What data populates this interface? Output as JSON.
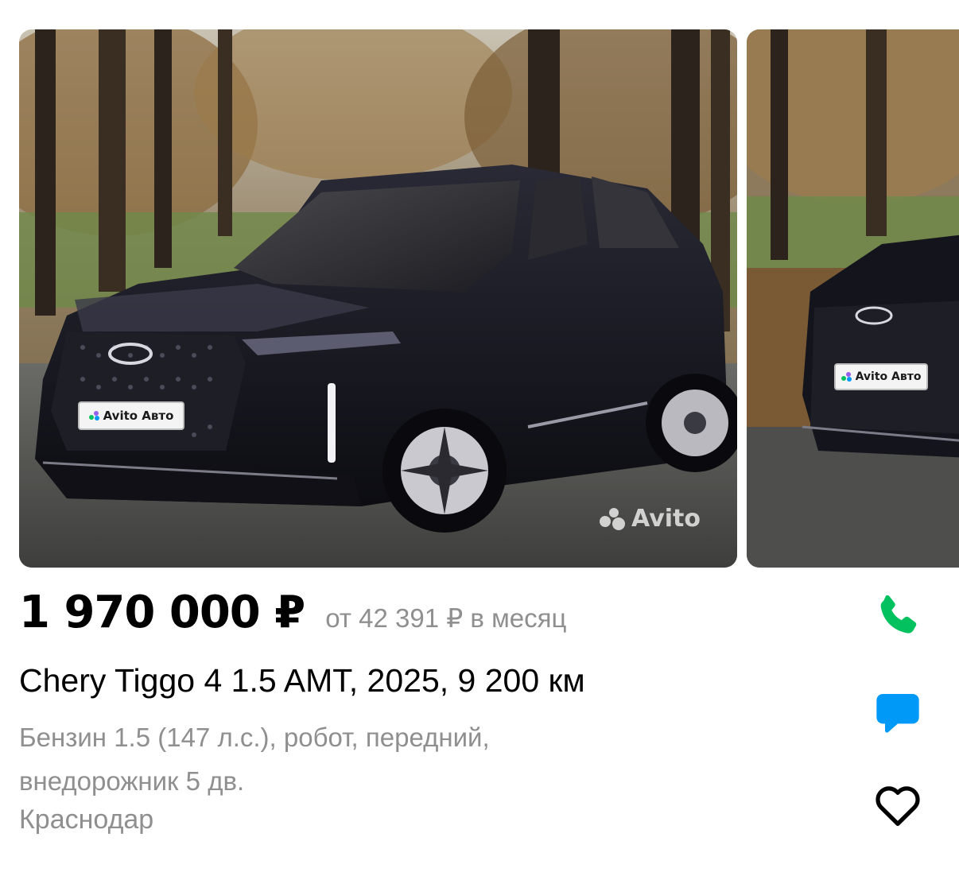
{
  "gallery": {
    "watermark": "Avito",
    "plate_text": "Avito Авто"
  },
  "listing": {
    "price": "1 970 000 ₽",
    "monthly": "от 42 391 ₽ в месяц",
    "title": "Chery Tiggo 4 1.5 AMT, 2025, 9 200 км",
    "specs_line1": "Бензин 1.5 (147 л.с.), робот, передний,",
    "specs_line2": "внедорожник 5 дв.",
    "city": "Краснодар"
  },
  "actions": {
    "call_icon": "phone-icon",
    "message_icon": "chat-bubble-icon",
    "favorite_icon": "heart-outline-icon"
  },
  "colors": {
    "call": "#04c15f",
    "message": "#0099f7",
    "muted_text": "#8f8f8f",
    "car_body": "#14141c"
  }
}
